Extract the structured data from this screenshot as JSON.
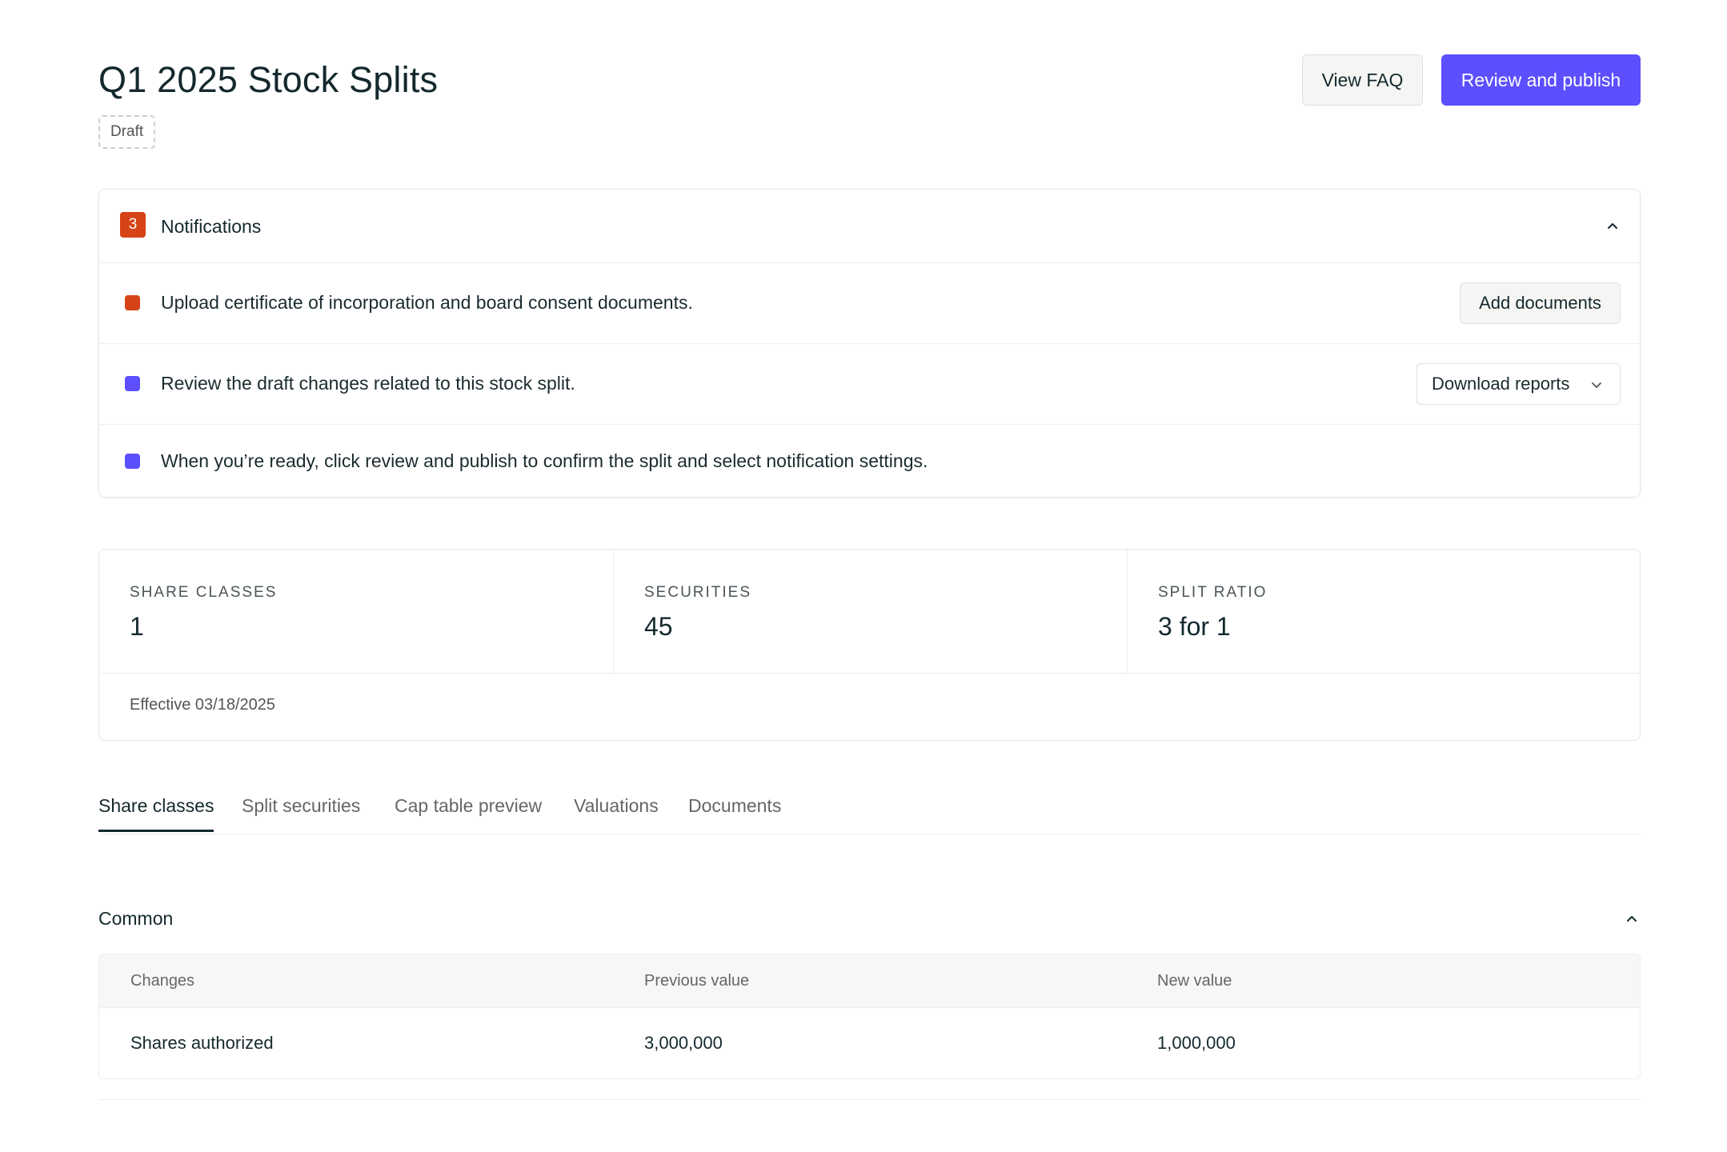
{
  "header": {
    "title": "Q1 2025 Stock Splits",
    "status_badge": "Draft",
    "faq_button": "View FAQ",
    "publish_button": "Review and publish"
  },
  "notifications": {
    "count": "3",
    "title": "Notifications",
    "items": [
      {
        "text": "Upload certificate of incorporation and board consent documents.",
        "color": "#d64316",
        "action": "Add documents"
      },
      {
        "text": "Review the draft changes related to this stock split.",
        "color": "#5b4fff",
        "action": "Download reports"
      },
      {
        "text": "When you’re ready, click review and publish to confirm the split and select notification settings.",
        "color": "#5b4fff"
      }
    ]
  },
  "stats": {
    "share_classes": {
      "label": "SHARE CLASSES",
      "value": "1"
    },
    "securities": {
      "label": "SECURITIES",
      "value": "45"
    },
    "split_ratio": {
      "label": "SPLIT RATIO",
      "value": "3 for 1"
    },
    "effective": "Effective 03/18/2025"
  },
  "tabs": [
    {
      "label": "Share classes",
      "active": true
    },
    {
      "label": "Split securities"
    },
    {
      "label": "Cap table preview"
    },
    {
      "label": "Valuations"
    },
    {
      "label": "Documents"
    }
  ],
  "section": {
    "title": "Common",
    "columns": [
      "Changes",
      "Previous value",
      "New value"
    ],
    "rows": [
      [
        "Shares authorized",
        "3,000,000",
        "1,000,000"
      ]
    ]
  },
  "colors": {
    "accent": "#5b4fff",
    "alert": "#d64316"
  }
}
